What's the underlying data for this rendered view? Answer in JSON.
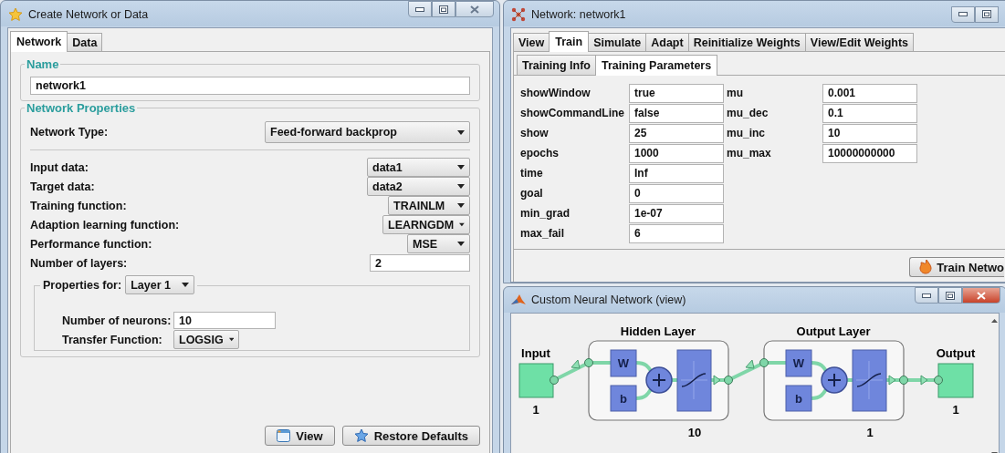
{
  "create_window": {
    "title": "Create Network or Data",
    "tabs": [
      {
        "label": "Network",
        "selected": true
      },
      {
        "label": "Data",
        "selected": false
      }
    ],
    "name_section": {
      "legend": "Name",
      "value": "network1"
    },
    "properties_section": {
      "legend": "Network Properties",
      "network_type": {
        "label": "Network Type:",
        "value": "Feed-forward backprop"
      },
      "fields": [
        {
          "label": "Input data:",
          "value": "data1",
          "kind": "dropdown"
        },
        {
          "label": "Target data:",
          "value": "data2",
          "kind": "dropdown"
        },
        {
          "label": "Training function:",
          "value": "TRAINLM",
          "kind": "dropdown"
        },
        {
          "label": "Adaption learning function:",
          "value": "LEARNGDM",
          "kind": "dropdown"
        },
        {
          "label": "Performance function:",
          "value": "MSE",
          "kind": "dropdown"
        },
        {
          "label": "Number of layers:",
          "value": "2",
          "kind": "text"
        }
      ],
      "layer_group": {
        "label": "Properties for:",
        "layer": "Layer 1",
        "fields": [
          {
            "label": "Number of neurons:",
            "value": "10",
            "kind": "text"
          },
          {
            "label": "Transfer Function:",
            "value": "LOGSIG",
            "kind": "dropdown"
          }
        ]
      }
    },
    "buttons": [
      {
        "label": "View",
        "kind": "view"
      },
      {
        "label": "Restore Defaults",
        "kind": "restore"
      }
    ]
  },
  "network_window": {
    "title": "Network: network1",
    "tabs": [
      {
        "label": "View",
        "selected": false
      },
      {
        "label": "Train",
        "selected": true
      },
      {
        "label": "Simulate",
        "selected": false
      },
      {
        "label": "Adapt",
        "selected": false
      },
      {
        "label": "Reinitialize Weights",
        "selected": false
      },
      {
        "label": "View/Edit Weights",
        "selected": false
      }
    ],
    "subtabs": [
      {
        "label": "Training Info",
        "selected": false
      },
      {
        "label": "Training Parameters",
        "selected": true
      }
    ],
    "parameters_left": [
      {
        "name": "showWindow",
        "value": "true"
      },
      {
        "name": "showCommandLine",
        "value": "false"
      },
      {
        "name": "show",
        "value": "25"
      },
      {
        "name": "epochs",
        "value": "1000"
      },
      {
        "name": "time",
        "value": "Inf"
      },
      {
        "name": "goal",
        "value": "0"
      },
      {
        "name": "min_grad",
        "value": "1e-07"
      },
      {
        "name": "max_fail",
        "value": "6"
      }
    ],
    "parameters_right": [
      {
        "name": "mu",
        "value": "0.001"
      },
      {
        "name": "mu_dec",
        "value": "0.1"
      },
      {
        "name": "mu_inc",
        "value": "10"
      },
      {
        "name": "mu_max",
        "value": "10000000000"
      }
    ],
    "train_button": "Train Netwo"
  },
  "view_window": {
    "title": "Custom Neural Network (view)",
    "diagram": {
      "input": {
        "label": "Input",
        "size": "1"
      },
      "layers": [
        {
          "title": "Hidden Layer",
          "weight": "W",
          "bias": "b",
          "size": "10"
        },
        {
          "title": "Output Layer",
          "weight": "W",
          "bias": "b",
          "size": "1"
        }
      ],
      "output": {
        "label": "Output",
        "size": "1"
      }
    }
  }
}
